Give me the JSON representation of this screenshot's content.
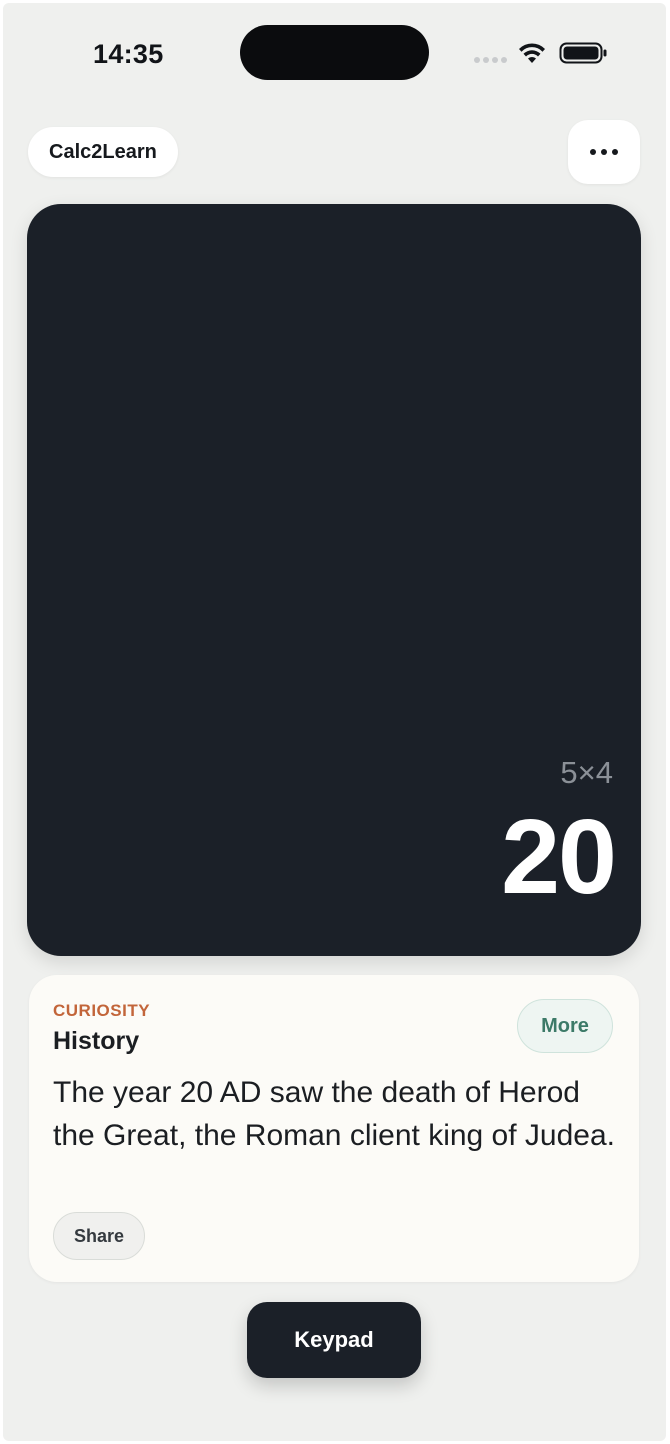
{
  "status_bar": {
    "time": "14:35",
    "icons": [
      "cellular-signal-icon",
      "wifi-icon",
      "battery-icon"
    ]
  },
  "header": {
    "app_name": "Calc2Learn",
    "menu_icon": "ellipsis-icon"
  },
  "display": {
    "expression": "5×4",
    "result": "20"
  },
  "fact": {
    "kicker": "CURIOSITY",
    "category": "History",
    "more_label": "More",
    "text": "The year 20 AD saw the death of Herod the Great, the Roman client king of Judea.",
    "share_label": "Share"
  },
  "footer": {
    "keypad_label": "Keypad"
  },
  "colors": {
    "background": "#eff0ee",
    "display_card": "#1b2028",
    "kicker": "#c2653a",
    "more_accent": "#3c7a68"
  }
}
